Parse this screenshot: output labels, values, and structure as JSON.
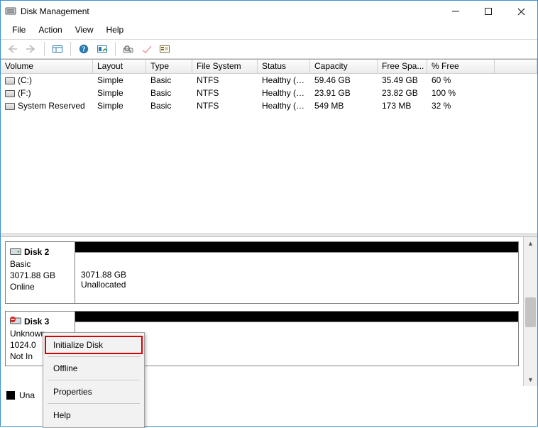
{
  "window": {
    "title": "Disk Management"
  },
  "menu": {
    "file": "File",
    "action": "Action",
    "view": "View",
    "help": "Help"
  },
  "columns": [
    "Volume",
    "Layout",
    "Type",
    "File System",
    "Status",
    "Capacity",
    "Free Spa...",
    "% Free"
  ],
  "volumes": [
    {
      "name": "(C:)",
      "layout": "Simple",
      "type": "Basic",
      "fs": "NTFS",
      "status": "Healthy (B...",
      "capacity": "59.46 GB",
      "free": "35.49 GB",
      "pct": "60 %"
    },
    {
      "name": "(F:)",
      "layout": "Simple",
      "type": "Basic",
      "fs": "NTFS",
      "status": "Healthy (P...",
      "capacity": "23.91 GB",
      "free": "23.82 GB",
      "pct": "100 %"
    },
    {
      "name": "System Reserved",
      "layout": "Simple",
      "type": "Basic",
      "fs": "NTFS",
      "status": "Healthy (S...",
      "capacity": "549 MB",
      "free": "173 MB",
      "pct": "32 %"
    }
  ],
  "disks": {
    "d2": {
      "name": "Disk 2",
      "type": "Basic",
      "size": "3071.88 GB",
      "state": "Online",
      "part_size": "3071.88 GB",
      "part_state": "Unallocated"
    },
    "d3": {
      "name": "Disk 3",
      "type": "Unknown",
      "size": "1024.0",
      "state": "Not In"
    }
  },
  "legend": {
    "unallocated": "Una"
  },
  "context_menu": {
    "initialize": "Initialize Disk",
    "offline": "Offline",
    "properties": "Properties",
    "help": "Help"
  }
}
